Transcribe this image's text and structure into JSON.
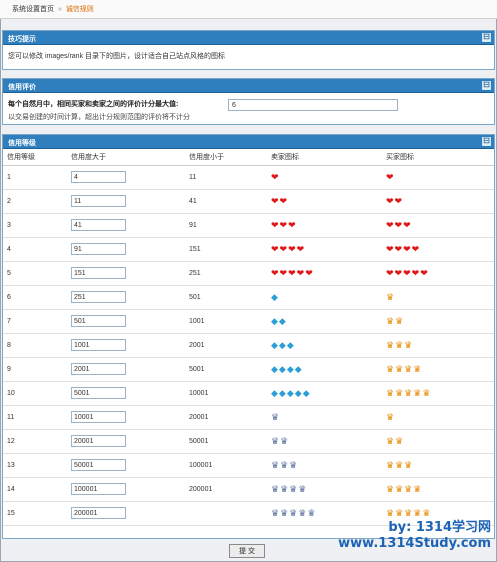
{
  "breadcrumb": {
    "home": "系统设置首页",
    "separator": "»",
    "current": "诚信规则"
  },
  "tips": {
    "title": "技巧提示",
    "text": "您可以修改 images/rank 目录下的图片，设计适合自己站点风格的图标"
  },
  "credit": {
    "title": "信用评价",
    "label_bold": "每个自然月中，相同买家和卖家之间的评价计分最大值:",
    "label_sub": "以交易创建的时间计算，超出计分规则范围的评价将不计分",
    "value": "6"
  },
  "levels": {
    "title": "信用等级",
    "headers": [
      "信用等级",
      "信用度大于",
      "信用度小于",
      "卖家图标",
      "买家图标"
    ],
    "rows": [
      {
        "level": "1",
        "gt": "4",
        "lt": "11",
        "seller_icon": "heart",
        "seller_count": 1,
        "buyer_icon": "heart",
        "buyer_count": 1
      },
      {
        "level": "2",
        "gt": "11",
        "lt": "41",
        "seller_icon": "heart",
        "seller_count": 2,
        "buyer_icon": "heart",
        "buyer_count": 2
      },
      {
        "level": "3",
        "gt": "41",
        "lt": "91",
        "seller_icon": "heart",
        "seller_count": 3,
        "buyer_icon": "heart",
        "buyer_count": 3
      },
      {
        "level": "4",
        "gt": "91",
        "lt": "151",
        "seller_icon": "heart",
        "seller_count": 4,
        "buyer_icon": "heart",
        "buyer_count": 4
      },
      {
        "level": "5",
        "gt": "151",
        "lt": "251",
        "seller_icon": "heart",
        "seller_count": 5,
        "buyer_icon": "heart",
        "buyer_count": 5
      },
      {
        "level": "6",
        "gt": "251",
        "lt": "501",
        "seller_icon": "diamond",
        "seller_count": 1,
        "buyer_icon": "crown",
        "buyer_count": 1
      },
      {
        "level": "7",
        "gt": "501",
        "lt": "1001",
        "seller_icon": "diamond",
        "seller_count": 2,
        "buyer_icon": "crown",
        "buyer_count": 2
      },
      {
        "level": "8",
        "gt": "1001",
        "lt": "2001",
        "seller_icon": "diamond",
        "seller_count": 3,
        "buyer_icon": "crown",
        "buyer_count": 3
      },
      {
        "level": "9",
        "gt": "2001",
        "lt": "5001",
        "seller_icon": "diamond",
        "seller_count": 4,
        "buyer_icon": "crown",
        "buyer_count": 4
      },
      {
        "level": "10",
        "gt": "5001",
        "lt": "10001",
        "seller_icon": "diamond",
        "seller_count": 5,
        "buyer_icon": "crown",
        "buyer_count": 5
      },
      {
        "level": "11",
        "gt": "10001",
        "lt": "20001",
        "seller_icon": "crown-b",
        "seller_count": 1,
        "buyer_icon": "crown",
        "buyer_count": 1
      },
      {
        "level": "12",
        "gt": "20001",
        "lt": "50001",
        "seller_icon": "crown-b",
        "seller_count": 2,
        "buyer_icon": "crown",
        "buyer_count": 2
      },
      {
        "level": "13",
        "gt": "50001",
        "lt": "100001",
        "seller_icon": "crown-b",
        "seller_count": 3,
        "buyer_icon": "crown",
        "buyer_count": 3
      },
      {
        "level": "14",
        "gt": "100001",
        "lt": "200001",
        "seller_icon": "crown-b",
        "seller_count": 4,
        "buyer_icon": "crown",
        "buyer_count": 4
      },
      {
        "level": "15",
        "gt": "200001",
        "lt": "",
        "seller_icon": "crown-b",
        "seller_count": 5,
        "buyer_icon": "crown",
        "buyer_count": 5
      }
    ]
  },
  "toggle_symbol": "⊟",
  "submit_label": "提 交",
  "watermark": {
    "line1": "by: 1314学习网",
    "line2": "www.1314Study.com"
  },
  "icon_glyphs": {
    "heart": "❤",
    "diamond": "◆",
    "crown": "♛",
    "crown-b": "♛"
  }
}
